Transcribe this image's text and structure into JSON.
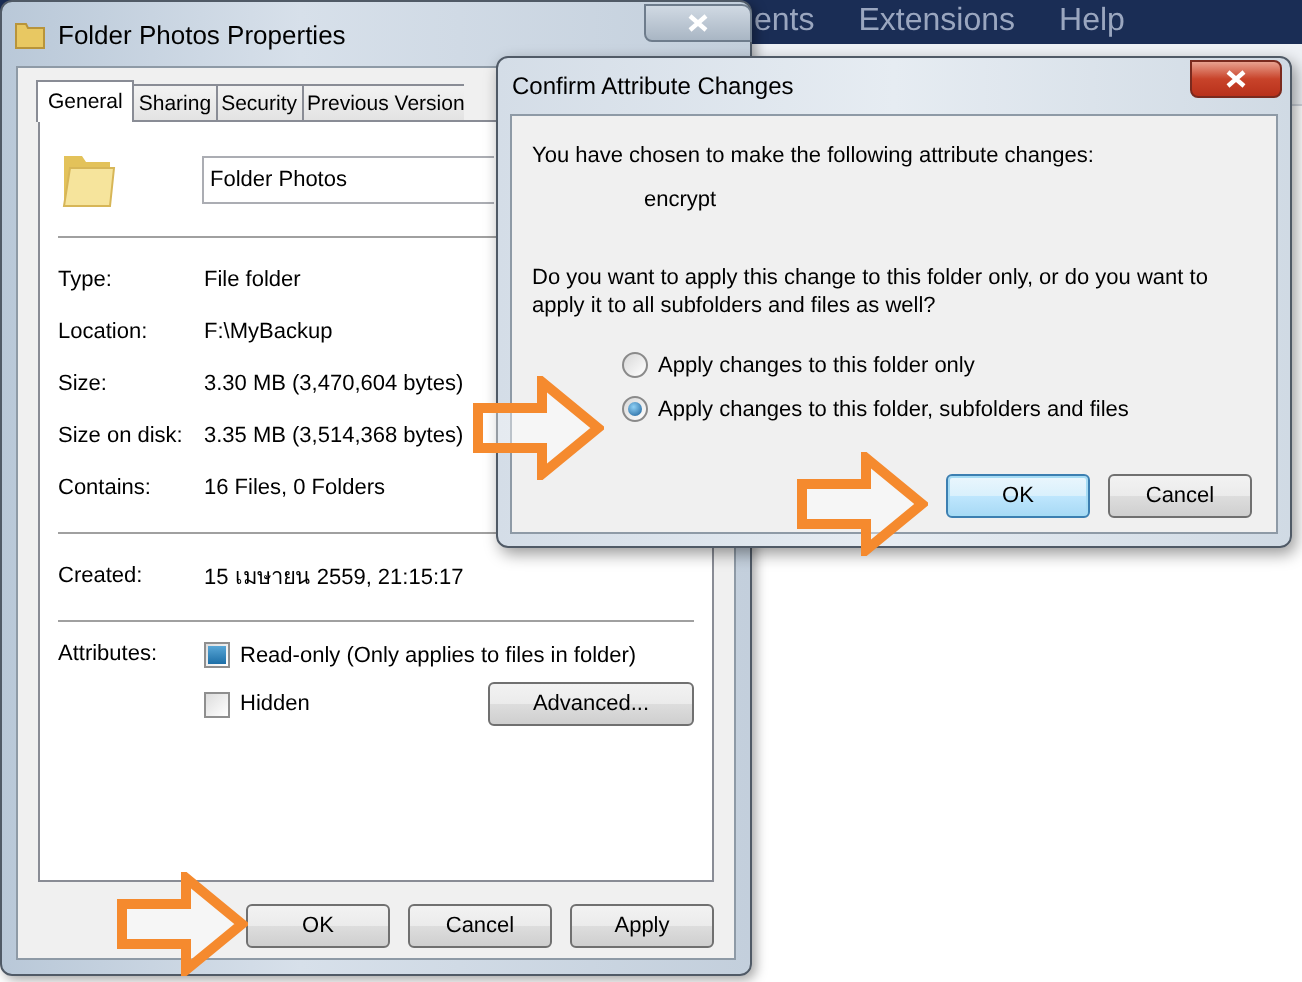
{
  "background_app": {
    "menu": [
      "ents",
      "Extensions",
      "Help"
    ]
  },
  "properties_window": {
    "title": "Folder Photos Properties",
    "tabs": [
      {
        "label": "General",
        "selected": true
      },
      {
        "label": "Sharing",
        "selected": false
      },
      {
        "label": "Security",
        "selected": false
      },
      {
        "label": "Previous Version",
        "selected": false
      }
    ],
    "name_field": {
      "value": "Folder Photos"
    },
    "detail_groups": [
      [
        {
          "label": "Type:",
          "value": "File folder"
        },
        {
          "label": "Location:",
          "value": "F:\\MyBackup"
        },
        {
          "label": "Size:",
          "value": "3.30 MB (3,470,604 bytes)"
        },
        {
          "label": "Size on disk:",
          "value": "3.35 MB (3,514,368 bytes)"
        },
        {
          "label": "Contains:",
          "value": "16 Files, 0 Folders"
        }
      ],
      [
        {
          "label": "Created:",
          "value": "15 เมษายน 2559, 21:15:17"
        }
      ]
    ],
    "attributes": {
      "label": "Attributes:",
      "options": [
        {
          "label": "Read-only (Only applies to files in folder)",
          "checked": false,
          "indeterminate": true
        },
        {
          "label": "Hidden",
          "checked": false,
          "indeterminate": false
        }
      ],
      "advanced_button": "Advanced..."
    },
    "buttons": [
      "OK",
      "Cancel",
      "Apply"
    ]
  },
  "confirm_dialog": {
    "title": "Confirm Attribute Changes",
    "message": "You have chosen to make the following attribute changes:",
    "change": "encrypt",
    "question": "Do you want to apply this change to this folder only, or do you want to apply it to all subfolders and files as well?",
    "options": [
      {
        "label": "Apply changes to this folder only",
        "selected": false
      },
      {
        "label": "Apply changes to this folder, subfolders and files",
        "selected": true
      }
    ],
    "buttons": [
      {
        "label": "OK",
        "default": true
      },
      {
        "label": "Cancel",
        "default": false
      }
    ]
  }
}
